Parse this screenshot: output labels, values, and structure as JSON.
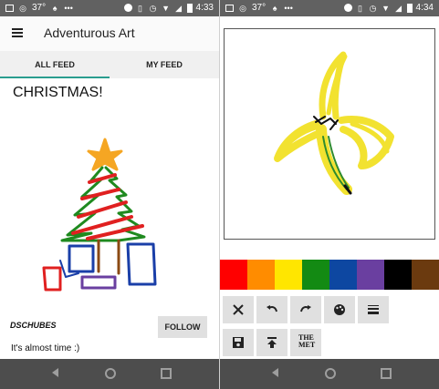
{
  "left_screen": {
    "statusbar": {
      "signal": "37°",
      "time": "4:33"
    },
    "appbar": {
      "title": "Adventurous Art"
    },
    "tabs": [
      {
        "label": "ALL FEED",
        "active": true
      },
      {
        "label": "MY FEED",
        "active": false
      }
    ],
    "post": {
      "title": "CHRISTMAS!",
      "author": "DSCHUBES",
      "follow_label": "FOLLOW",
      "caption": "It's almost time :)"
    }
  },
  "right_screen": {
    "statusbar": {
      "signal": "37°",
      "time": "4:34"
    },
    "palette": [
      "#ff0000",
      "#ff8c00",
      "#ffe600",
      "#138a13",
      "#0d47a1",
      "#6a3fa0",
      "#000000",
      "#6b3a0f"
    ],
    "tools_row1": [
      {
        "name": "clear",
        "icon": "close-icon"
      },
      {
        "name": "undo",
        "icon": "undo-icon"
      },
      {
        "name": "redo",
        "icon": "redo-icon"
      },
      {
        "name": "color",
        "icon": "palette-icon"
      },
      {
        "name": "brush-size",
        "icon": "line-weight-icon"
      }
    ],
    "tools_row2": [
      {
        "name": "save",
        "icon": "save-icon"
      },
      {
        "name": "publish",
        "icon": "upload-icon"
      },
      {
        "name": "met",
        "icon": "met-logo"
      }
    ]
  }
}
